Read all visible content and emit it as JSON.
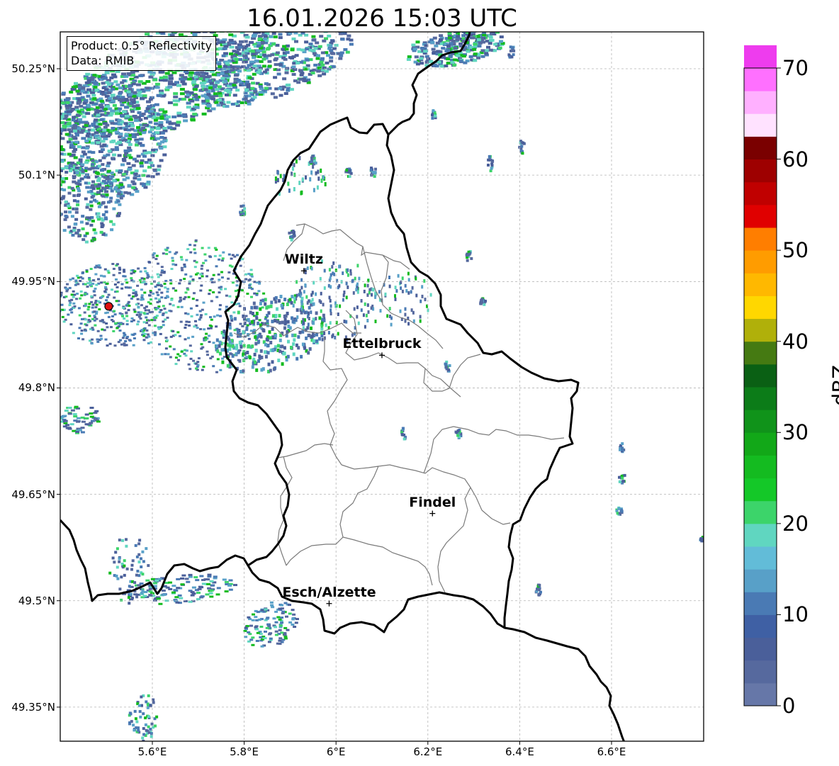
{
  "title": "16.01.2026 15:03 UTC",
  "info": {
    "product": "Product: 0.5° Reflectivity",
    "data_source": "Data: RMIB"
  },
  "lat_ticks": [
    {
      "value": 50.25,
      "label": "50.25°N"
    },
    {
      "value": 50.1,
      "label": "50.1°N"
    },
    {
      "value": 49.95,
      "label": "49.95°N"
    },
    {
      "value": 49.8,
      "label": "49.8°N"
    },
    {
      "value": 49.65,
      "label": "49.65°N"
    },
    {
      "value": 49.5,
      "label": "49.5°N"
    },
    {
      "value": 49.35,
      "label": "49.35°N"
    }
  ],
  "lon_ticks": [
    {
      "value": 5.6,
      "label": "5.6°E"
    },
    {
      "value": 5.8,
      "label": "5.8°E"
    },
    {
      "value": 6.0,
      "label": "6°E"
    },
    {
      "value": 6.2,
      "label": "6.2°E"
    },
    {
      "value": 6.4,
      "label": "6.4°E"
    },
    {
      "value": 6.6,
      "label": "6.6°E"
    }
  ],
  "cities": [
    {
      "name": "Wiltz",
      "lon": 5.93,
      "lat": 49.965
    },
    {
      "name": "Ettelbruck",
      "lon": 6.1,
      "lat": 49.846
    },
    {
      "name": "Findel",
      "lon": 6.21,
      "lat": 49.623
    },
    {
      "name": "Esch/Alzette",
      "lon": 5.985,
      "lat": 49.496
    }
  ],
  "radar_site": {
    "lon": 5.505,
    "lat": 49.915,
    "color": "#dd1111"
  },
  "colorbar": {
    "label": "dBZ",
    "ticks": [
      "0",
      "10",
      "20",
      "30",
      "40",
      "50",
      "60",
      "70"
    ],
    "min": 0,
    "max": 70,
    "step": 2.5,
    "colors": [
      "#6677a8",
      "#56699e",
      "#4a5f9a",
      "#3f60a4",
      "#4a7ab4",
      "#58a0c8",
      "#62bcd8",
      "#60d6c0",
      "#3cd46a",
      "#14c828",
      "#14bb20",
      "#12a818",
      "#10931a",
      "#0c7c18",
      "#0a6014",
      "#457a12",
      "#b0b00a",
      "#ffd700",
      "#ffb800",
      "#ff9c00",
      "#ff7e00",
      "#e00000",
      "#c00000",
      "#9e0000",
      "#7a0000",
      "#ffe2ff",
      "#ffb0ff",
      "#ff70ff",
      "#ee3cee"
    ]
  },
  "colors": {
    "border": "#000000",
    "cantons": "#7a7a7a",
    "grid": "#b4b4b4"
  }
}
